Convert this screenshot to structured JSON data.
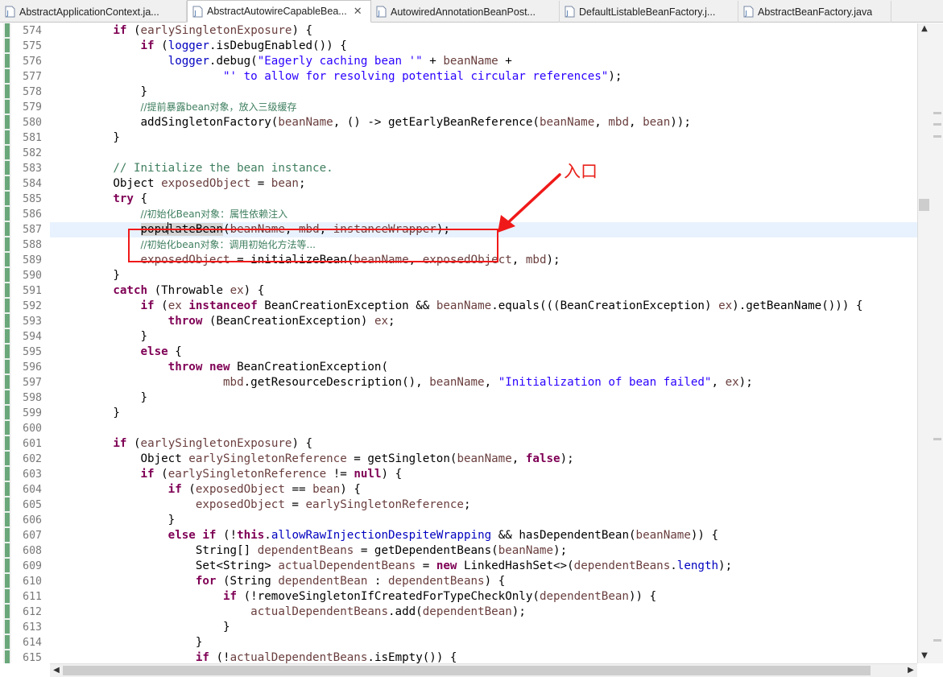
{
  "tabs": [
    {
      "label": "AbstractApplicationContext.ja...",
      "active": false
    },
    {
      "label": "AbstractAutowireCapableBea...",
      "active": true
    },
    {
      "label": "AutowiredAnnotationBeanPost...",
      "active": false
    },
    {
      "label": "DefaultListableBeanFactory.j...",
      "active": false
    },
    {
      "label": "AbstractBeanFactory.java",
      "active": false
    }
  ],
  "tab_close_glyph": "✕",
  "annotation": {
    "label": "入口",
    "color": "#f01919"
  },
  "current_line": "587",
  "line_numbers": [
    "574",
    "575",
    "576",
    "577",
    "578",
    "579",
    "580",
    "581",
    "582",
    "583",
    "584",
    "585",
    "586",
    "587",
    "588",
    "589",
    "590",
    "591",
    "592",
    "593",
    "594",
    "595",
    "596",
    "597",
    "598",
    "599",
    "600",
    "601",
    "602",
    "603",
    "604",
    "605",
    "606",
    "607",
    "608",
    "609",
    "610",
    "611",
    "612",
    "613",
    "614",
    "615"
  ],
  "colors": {
    "keyword": "#7f0055",
    "string": "#2a00ff",
    "comment": "#3f7f5f",
    "field": "#0000c0",
    "current_line_bg": "#e8f2fe"
  },
  "code_lines": [
    {
      "t": [
        [
          "        ",
          ""
        ],
        [
          "if",
          "kw"
        ],
        [
          " (",
          ""
        ],
        [
          "earlySingletonExposure",
          "lv"
        ],
        [
          ") {",
          ""
        ]
      ]
    },
    {
      "t": [
        [
          "            ",
          ""
        ],
        [
          "if",
          "kw"
        ],
        [
          " (",
          ""
        ],
        [
          "logger",
          "fld"
        ],
        [
          ".isDebugEnabled()) {",
          ""
        ]
      ]
    },
    {
      "t": [
        [
          "                ",
          ""
        ],
        [
          "logger",
          "fld"
        ],
        [
          ".debug(",
          ""
        ],
        [
          "\"Eagerly caching bean '\"",
          "str"
        ],
        [
          " + ",
          ""
        ],
        [
          "beanName",
          "lv"
        ],
        [
          " +",
          ""
        ]
      ]
    },
    {
      "t": [
        [
          "                        ",
          ""
        ],
        [
          "\"' to allow for resolving potential circular references\"",
          "str"
        ],
        [
          ");",
          ""
        ]
      ]
    },
    {
      "t": [
        [
          "            }",
          ""
        ]
      ]
    },
    {
      "t": [
        [
          "            ",
          ""
        ],
        [
          "//提前暴露bean对象，放入三级缓存",
          "cmz"
        ]
      ]
    },
    {
      "t": [
        [
          "            addSingletonFactory(",
          ""
        ],
        [
          "beanName",
          "lv"
        ],
        [
          ", () -> getEarlyBeanReference(",
          ""
        ],
        [
          "beanName",
          "lv"
        ],
        [
          ", ",
          ""
        ],
        [
          "mbd",
          "lv"
        ],
        [
          ", ",
          ""
        ],
        [
          "bean",
          "lv"
        ],
        [
          "));",
          ""
        ]
      ]
    },
    {
      "t": [
        [
          "        }",
          ""
        ]
      ]
    },
    {
      "t": [
        [
          "",
          ""
        ]
      ]
    },
    {
      "t": [
        [
          "        ",
          ""
        ],
        [
          "// Initialize the bean instance.",
          "cm"
        ]
      ]
    },
    {
      "t": [
        [
          "        Object ",
          ""
        ],
        [
          "exposedObject",
          "lv"
        ],
        [
          " = ",
          ""
        ],
        [
          "bean",
          "lv"
        ],
        [
          ";",
          ""
        ]
      ]
    },
    {
      "t": [
        [
          "        ",
          ""
        ],
        [
          "try",
          "kw"
        ],
        [
          " {",
          ""
        ]
      ]
    },
    {
      "t": [
        [
          "            ",
          ""
        ],
        [
          "//初始化Bean对象：属性依赖注入",
          "cmz"
        ]
      ]
    },
    {
      "t": [
        [
          "            ",
          ""
        ],
        [
          "popu",
          "occ"
        ],
        [
          "|",
          "caret"
        ],
        [
          "lateBean",
          "occ"
        ],
        [
          "(",
          ""
        ],
        [
          "beanName",
          "lv"
        ],
        [
          ", ",
          ""
        ],
        [
          "mbd",
          "lv"
        ],
        [
          ", ",
          ""
        ],
        [
          "instanceWrapper",
          "lv"
        ],
        [
          ");",
          ""
        ]
      ]
    },
    {
      "t": [
        [
          "            ",
          ""
        ],
        [
          "//初始化bean对象：调用初始化方法等...",
          "cmz"
        ]
      ]
    },
    {
      "t": [
        [
          "            ",
          ""
        ],
        [
          "exposedObject",
          "lv"
        ],
        [
          " = initializeBean(",
          ""
        ],
        [
          "beanName",
          "lv"
        ],
        [
          ", ",
          ""
        ],
        [
          "exposedObject",
          "lv"
        ],
        [
          ", ",
          ""
        ],
        [
          "mbd",
          "lv"
        ],
        [
          ");",
          ""
        ]
      ]
    },
    {
      "t": [
        [
          "        }",
          ""
        ]
      ]
    },
    {
      "t": [
        [
          "        ",
          ""
        ],
        [
          "catch",
          "kw"
        ],
        [
          " (Throwable ",
          ""
        ],
        [
          "ex",
          "lv"
        ],
        [
          ") {",
          ""
        ]
      ]
    },
    {
      "t": [
        [
          "            ",
          ""
        ],
        [
          "if",
          "kw"
        ],
        [
          " (",
          ""
        ],
        [
          "ex",
          "lv"
        ],
        [
          " ",
          ""
        ],
        [
          "instanceof",
          "kw"
        ],
        [
          " BeanCreationException && ",
          ""
        ],
        [
          "beanName",
          "lv"
        ],
        [
          ".equals(((BeanCreationException) ",
          ""
        ],
        [
          "ex",
          "lv"
        ],
        [
          ").getBeanName())) {",
          ""
        ]
      ]
    },
    {
      "t": [
        [
          "                ",
          ""
        ],
        [
          "throw",
          "kw"
        ],
        [
          " (BeanCreationException) ",
          ""
        ],
        [
          "ex",
          "lv"
        ],
        [
          ";",
          ""
        ]
      ]
    },
    {
      "t": [
        [
          "            }",
          ""
        ]
      ]
    },
    {
      "t": [
        [
          "            ",
          ""
        ],
        [
          "else",
          "kw"
        ],
        [
          " {",
          ""
        ]
      ]
    },
    {
      "t": [
        [
          "                ",
          ""
        ],
        [
          "throw",
          "kw"
        ],
        [
          " ",
          ""
        ],
        [
          "new",
          "kw"
        ],
        [
          " BeanCreationException(",
          ""
        ]
      ]
    },
    {
      "t": [
        [
          "                        ",
          ""
        ],
        [
          "mbd",
          "lv"
        ],
        [
          ".getResourceDescription(), ",
          ""
        ],
        [
          "beanName",
          "lv"
        ],
        [
          ", ",
          ""
        ],
        [
          "\"Initialization of bean failed\"",
          "str"
        ],
        [
          ", ",
          ""
        ],
        [
          "ex",
          "lv"
        ],
        [
          ");",
          ""
        ]
      ]
    },
    {
      "t": [
        [
          "            }",
          ""
        ]
      ]
    },
    {
      "t": [
        [
          "        }",
          ""
        ]
      ]
    },
    {
      "t": [
        [
          "",
          ""
        ]
      ]
    },
    {
      "t": [
        [
          "        ",
          ""
        ],
        [
          "if",
          "kw"
        ],
        [
          " (",
          ""
        ],
        [
          "earlySingletonExposure",
          "lv"
        ],
        [
          ") {",
          ""
        ]
      ]
    },
    {
      "t": [
        [
          "            Object ",
          ""
        ],
        [
          "earlySingletonReference",
          "lv"
        ],
        [
          " = getSingleton(",
          ""
        ],
        [
          "beanName",
          "lv"
        ],
        [
          ", ",
          ""
        ],
        [
          "false",
          "kw"
        ],
        [
          ");",
          ""
        ]
      ]
    },
    {
      "t": [
        [
          "            ",
          ""
        ],
        [
          "if",
          "kw"
        ],
        [
          " (",
          ""
        ],
        [
          "earlySingletonReference",
          "lv"
        ],
        [
          " != ",
          ""
        ],
        [
          "null",
          "kw"
        ],
        [
          ") {",
          ""
        ]
      ]
    },
    {
      "t": [
        [
          "                ",
          ""
        ],
        [
          "if",
          "kw"
        ],
        [
          " (",
          ""
        ],
        [
          "exposedObject",
          "lv"
        ],
        [
          " == ",
          ""
        ],
        [
          "bean",
          "lv"
        ],
        [
          ") {",
          ""
        ]
      ]
    },
    {
      "t": [
        [
          "                    ",
          ""
        ],
        [
          "exposedObject",
          "lv"
        ],
        [
          " = ",
          ""
        ],
        [
          "earlySingletonReference",
          "lv"
        ],
        [
          ";",
          ""
        ]
      ]
    },
    {
      "t": [
        [
          "                }",
          ""
        ]
      ]
    },
    {
      "t": [
        [
          "                ",
          ""
        ],
        [
          "else",
          "kw"
        ],
        [
          " ",
          ""
        ],
        [
          "if",
          "kw"
        ],
        [
          " (!",
          ""
        ],
        [
          "this",
          "kw"
        ],
        [
          ".",
          ""
        ],
        [
          "allowRawInjectionDespiteWrapping",
          "fld"
        ],
        [
          " && hasDependentBean(",
          ""
        ],
        [
          "beanName",
          "lv"
        ],
        [
          ")) {",
          ""
        ]
      ]
    },
    {
      "t": [
        [
          "                    String[] ",
          ""
        ],
        [
          "dependentBeans",
          "lv"
        ],
        [
          " = getDependentBeans(",
          ""
        ],
        [
          "beanName",
          "lv"
        ],
        [
          ");",
          ""
        ]
      ]
    },
    {
      "t": [
        [
          "                    Set<String> ",
          ""
        ],
        [
          "actualDependentBeans",
          "lv"
        ],
        [
          " = ",
          ""
        ],
        [
          "new",
          "kw"
        ],
        [
          " LinkedHashSet<>(",
          ""
        ],
        [
          "dependentBeans",
          "lv"
        ],
        [
          ".",
          ""
        ],
        [
          "length",
          "fld"
        ],
        [
          ");",
          ""
        ]
      ]
    },
    {
      "t": [
        [
          "                    ",
          ""
        ],
        [
          "for",
          "kw"
        ],
        [
          " (String ",
          ""
        ],
        [
          "dependentBean",
          "lv"
        ],
        [
          " : ",
          ""
        ],
        [
          "dependentBeans",
          "lv"
        ],
        [
          ") {",
          ""
        ]
      ]
    },
    {
      "t": [
        [
          "                        ",
          ""
        ],
        [
          "if",
          "kw"
        ],
        [
          " (!removeSingletonIfCreatedForTypeCheckOnly(",
          ""
        ],
        [
          "dependentBean",
          "lv"
        ],
        [
          ")) {",
          ""
        ]
      ]
    },
    {
      "t": [
        [
          "                            ",
          ""
        ],
        [
          "actualDependentBeans",
          "lv"
        ],
        [
          ".add(",
          ""
        ],
        [
          "dependentBean",
          "lv"
        ],
        [
          ");",
          ""
        ]
      ]
    },
    {
      "t": [
        [
          "                        }",
          ""
        ]
      ]
    },
    {
      "t": [
        [
          "                    }",
          ""
        ]
      ]
    },
    {
      "t": [
        [
          "                    ",
          ""
        ],
        [
          "if",
          "kw"
        ],
        [
          " (!",
          ""
        ],
        [
          "actualDependentBeans",
          "lv"
        ],
        [
          ".isEmpty()) {",
          ""
        ]
      ]
    }
  ]
}
